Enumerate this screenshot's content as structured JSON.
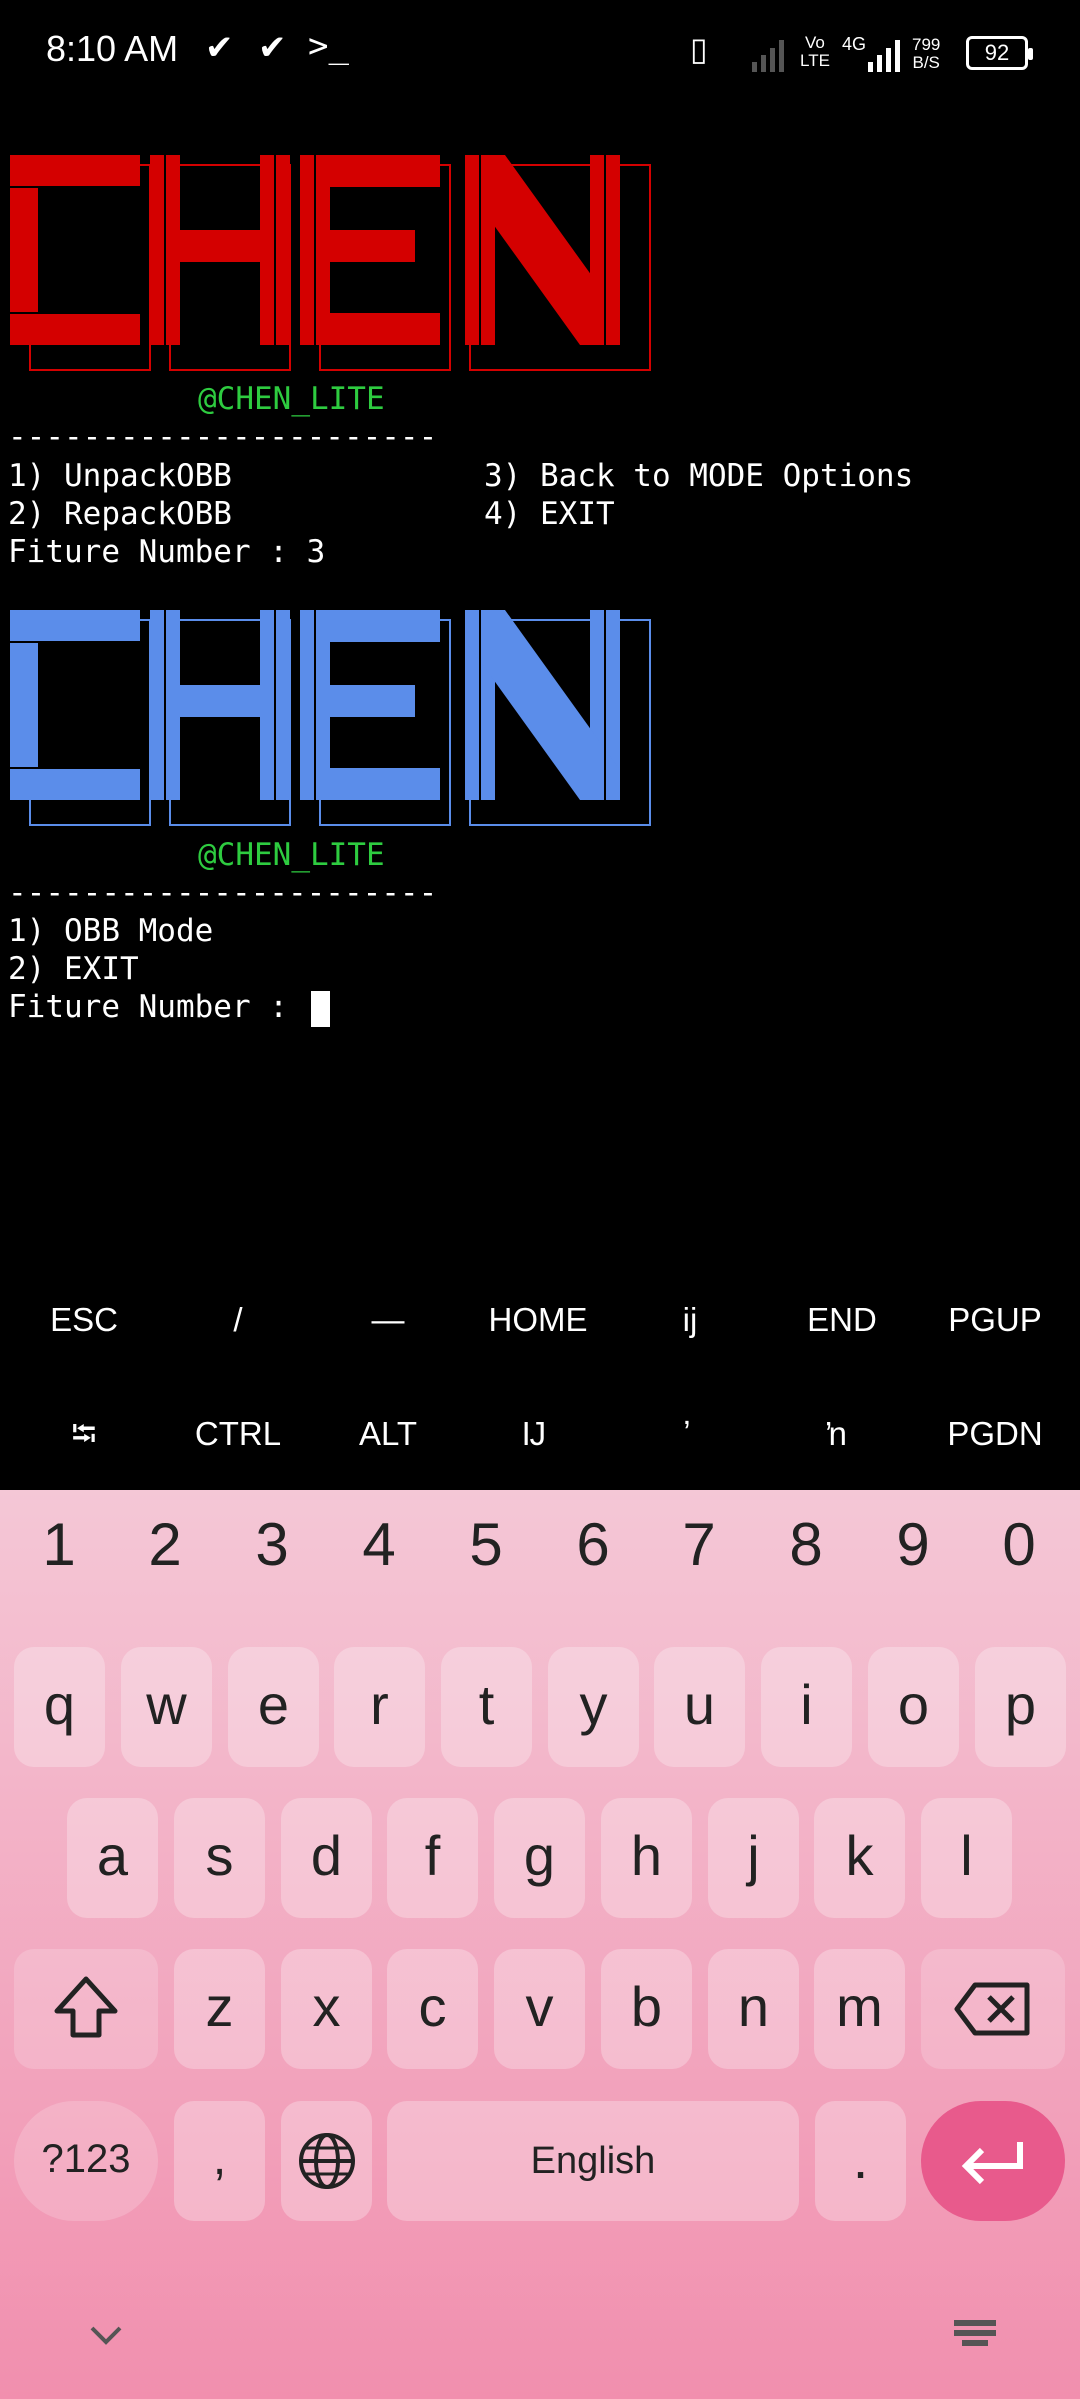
{
  "status": {
    "time": "8:10 AM",
    "net_label_top": "Vo",
    "net_label_bottom": "LTE",
    "net_4g": "4G",
    "speed_value": "799",
    "speed_unit": "B/S",
    "battery": "92"
  },
  "terminal": {
    "logo1_text": "CHEN",
    "logo2_text": "CHEN",
    "handle1": "@CHEN_LITE",
    "handle2": "@CHEN_LITE",
    "divider1": "-----------------------",
    "divider2": "-----------------------",
    "menu1": [
      "1) UnpackOBB",
      "2) RepackOBB",
      "3) Back to MODE Options",
      "4) EXIT"
    ],
    "prompt1": "Fiture Number : 3",
    "menu2": [
      "1) OBB Mode",
      "2) EXIT"
    ],
    "prompt2": "Fiture Number : "
  },
  "extra_keys": {
    "row1": [
      "ESC",
      "/",
      "—",
      "HOME",
      "ij",
      "END",
      "PGUP"
    ],
    "row2": [
      "⭾",
      "CTRL",
      "ALT",
      "Ĳ",
      "ʼ",
      "ŉ",
      "PGDN"
    ]
  },
  "keyboard": {
    "numbers": [
      "1",
      "2",
      "3",
      "4",
      "5",
      "6",
      "7",
      "8",
      "9",
      "0"
    ],
    "row1": [
      "q",
      "w",
      "e",
      "r",
      "t",
      "y",
      "u",
      "i",
      "o",
      "p"
    ],
    "row2": [
      "a",
      "s",
      "d",
      "f",
      "g",
      "h",
      "j",
      "k",
      "l"
    ],
    "row3": [
      "z",
      "x",
      "c",
      "v",
      "b",
      "n",
      "m"
    ],
    "symbols_label": "?123",
    "comma": ",",
    "space_label": "English",
    "period": "."
  },
  "colors": {
    "logo1": "#d40000",
    "logo2": "#5b8dea",
    "handle": "#2ecc40",
    "enter_key": "#e85a8c"
  }
}
